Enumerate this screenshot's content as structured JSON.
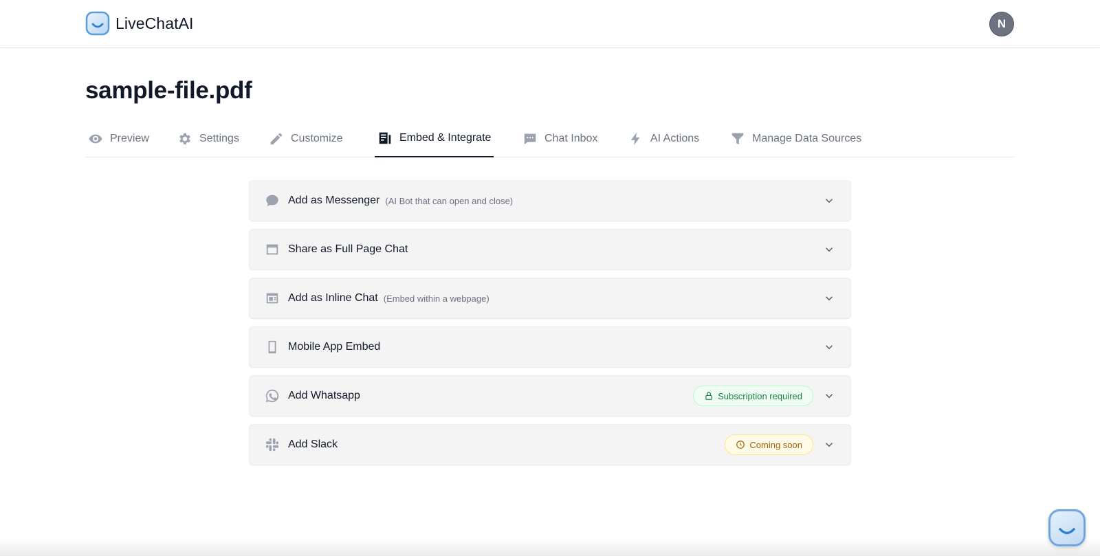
{
  "app": {
    "name": "LiveChatAI"
  },
  "user": {
    "initial": "N"
  },
  "page": {
    "title": "sample-file.pdf"
  },
  "tabs": [
    {
      "label": "Preview",
      "icon": "eye-icon"
    },
    {
      "label": "Settings",
      "icon": "gear-icon"
    },
    {
      "label": "Customize",
      "icon": "pencil-icon"
    },
    {
      "label": "Embed & Integrate",
      "icon": "embed-icon",
      "active": true
    },
    {
      "label": "Chat Inbox",
      "icon": "chat-bubble-icon"
    },
    {
      "label": "AI Actions",
      "icon": "lightning-icon"
    },
    {
      "label": "Manage Data Sources",
      "icon": "funnel-icon"
    }
  ],
  "panels": [
    {
      "title": "Add as Messenger",
      "subtitle": "(AI Bot that can open and close)",
      "icon": "speech-bubble-icon"
    },
    {
      "title": "Share as Full Page Chat",
      "subtitle": "",
      "icon": "browser-window-icon"
    },
    {
      "title": "Add as Inline Chat",
      "subtitle": "(Embed within a webpage)",
      "icon": "inline-layout-icon"
    },
    {
      "title": "Mobile App Embed",
      "subtitle": "",
      "icon": "mobile-phone-icon"
    },
    {
      "title": "Add Whatsapp",
      "subtitle": "",
      "icon": "whatsapp-icon",
      "badge": {
        "label": "Subscription required",
        "icon": "lock-icon",
        "color": "#15803d"
      }
    },
    {
      "title": "Add Slack",
      "subtitle": "",
      "icon": "slack-icon",
      "badge": {
        "label": "Coming soon",
        "icon": "clock-icon",
        "color": "#a16207"
      }
    }
  ],
  "colors": {
    "accent": "#111827",
    "muted": "#6b7280",
    "panel_bg": "#f4f4f5"
  }
}
